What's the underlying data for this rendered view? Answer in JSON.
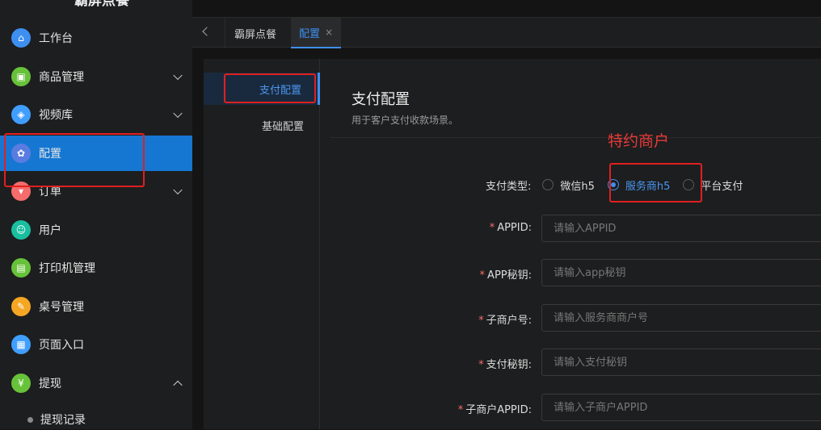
{
  "sidebar": {
    "brand": "霸屏点餐",
    "items": [
      {
        "label": "工作台",
        "icon": "home-icon",
        "color": "#3d8ff0"
      },
      {
        "label": "商品管理",
        "icon": "goods-icon",
        "color": "#67c23a"
      },
      {
        "label": "视频库",
        "icon": "cube-icon",
        "color": "#409eff"
      },
      {
        "label": "配置",
        "icon": "settings-icon",
        "color": "#5a7ce0"
      },
      {
        "label": "订单",
        "icon": "cart-icon",
        "color": "#f56c6c"
      },
      {
        "label": "用户",
        "icon": "users-icon",
        "color": "#19be9f"
      },
      {
        "label": "打印机管理",
        "icon": "printer-icon",
        "color": "#67c23a"
      },
      {
        "label": "桌号管理",
        "icon": "table-icon",
        "color": "#f5a623"
      },
      {
        "label": "页面入口",
        "icon": "page-icon",
        "color": "#409eff"
      },
      {
        "label": "提现",
        "icon": "yen-icon",
        "color": "#67c23a"
      }
    ],
    "sub_item": "提现记录"
  },
  "tabs": {
    "items": [
      "霸屏点餐",
      "配置"
    ],
    "close": "×"
  },
  "submenu": {
    "items": [
      "支付配置",
      "基础配置"
    ]
  },
  "form": {
    "title": "支付配置",
    "desc": "用于客户支付收款场景。",
    "pay_type_label": "支付类型:",
    "radios": [
      "微信h5",
      "服务商h5",
      "平台支付"
    ],
    "selected": "服务商h5",
    "fields": [
      {
        "label": "APPID:",
        "placeholder": "请输入APPID"
      },
      {
        "label": "APP秘钥:",
        "placeholder": "请输入app秘钥"
      },
      {
        "label": "子商户号:",
        "placeholder": "请输入服务商商户号"
      },
      {
        "label": "支付秘钥:",
        "placeholder": "请输入支付秘钥"
      },
      {
        "label": "子商户APPID:",
        "placeholder": "请输入子商户APPID"
      }
    ],
    "required_mark": "*"
  },
  "annotation": {
    "text": "特约商户",
    "color": "#e02020"
  }
}
